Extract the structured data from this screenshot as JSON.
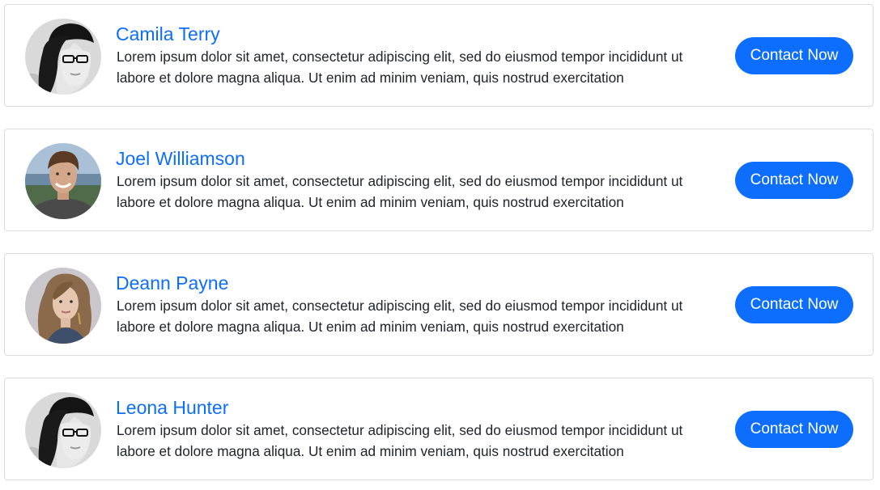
{
  "contacts": [
    {
      "name": "Camila Terry",
      "description": "Lorem ipsum dolor sit amet, consectetur adipiscing elit, sed do eiusmod tempor incididunt ut labore et dolore magna aliqua. Ut enim ad minim veniam, quis nostrud exercitation",
      "button_label": "Contact Now",
      "avatar": "woman-beanie-glasses-avatar"
    },
    {
      "name": "Joel Williamson",
      "description": "Lorem ipsum dolor sit amet, consectetur adipiscing elit, sed do eiusmod tempor incididunt ut labore et dolore magna aliqua. Ut enim ad minim veniam, quis nostrud exercitation",
      "button_label": "Contact Now",
      "avatar": "young-man-outdoor-avatar"
    },
    {
      "name": "Deann Payne",
      "description": "Lorem ipsum dolor sit amet, consectetur adipiscing elit, sed do eiusmod tempor incididunt ut labore et dolore magna aliqua. Ut enim ad minim veniam, quis nostrud exercitation",
      "button_label": "Contact Now",
      "avatar": "woman-curly-hair-avatar"
    },
    {
      "name": "Leona Hunter",
      "description": "Lorem ipsum dolor sit amet, consectetur adipiscing elit, sed do eiusmod tempor incididunt ut labore et dolore magna aliqua. Ut enim ad minim veniam, quis nostrud exercitation",
      "button_label": "Contact Now",
      "avatar": "woman-beanie-glasses-avatar"
    }
  ],
  "colors": {
    "accent": "#0d6efd",
    "text": "#212529",
    "border": "#dcdcdc"
  }
}
